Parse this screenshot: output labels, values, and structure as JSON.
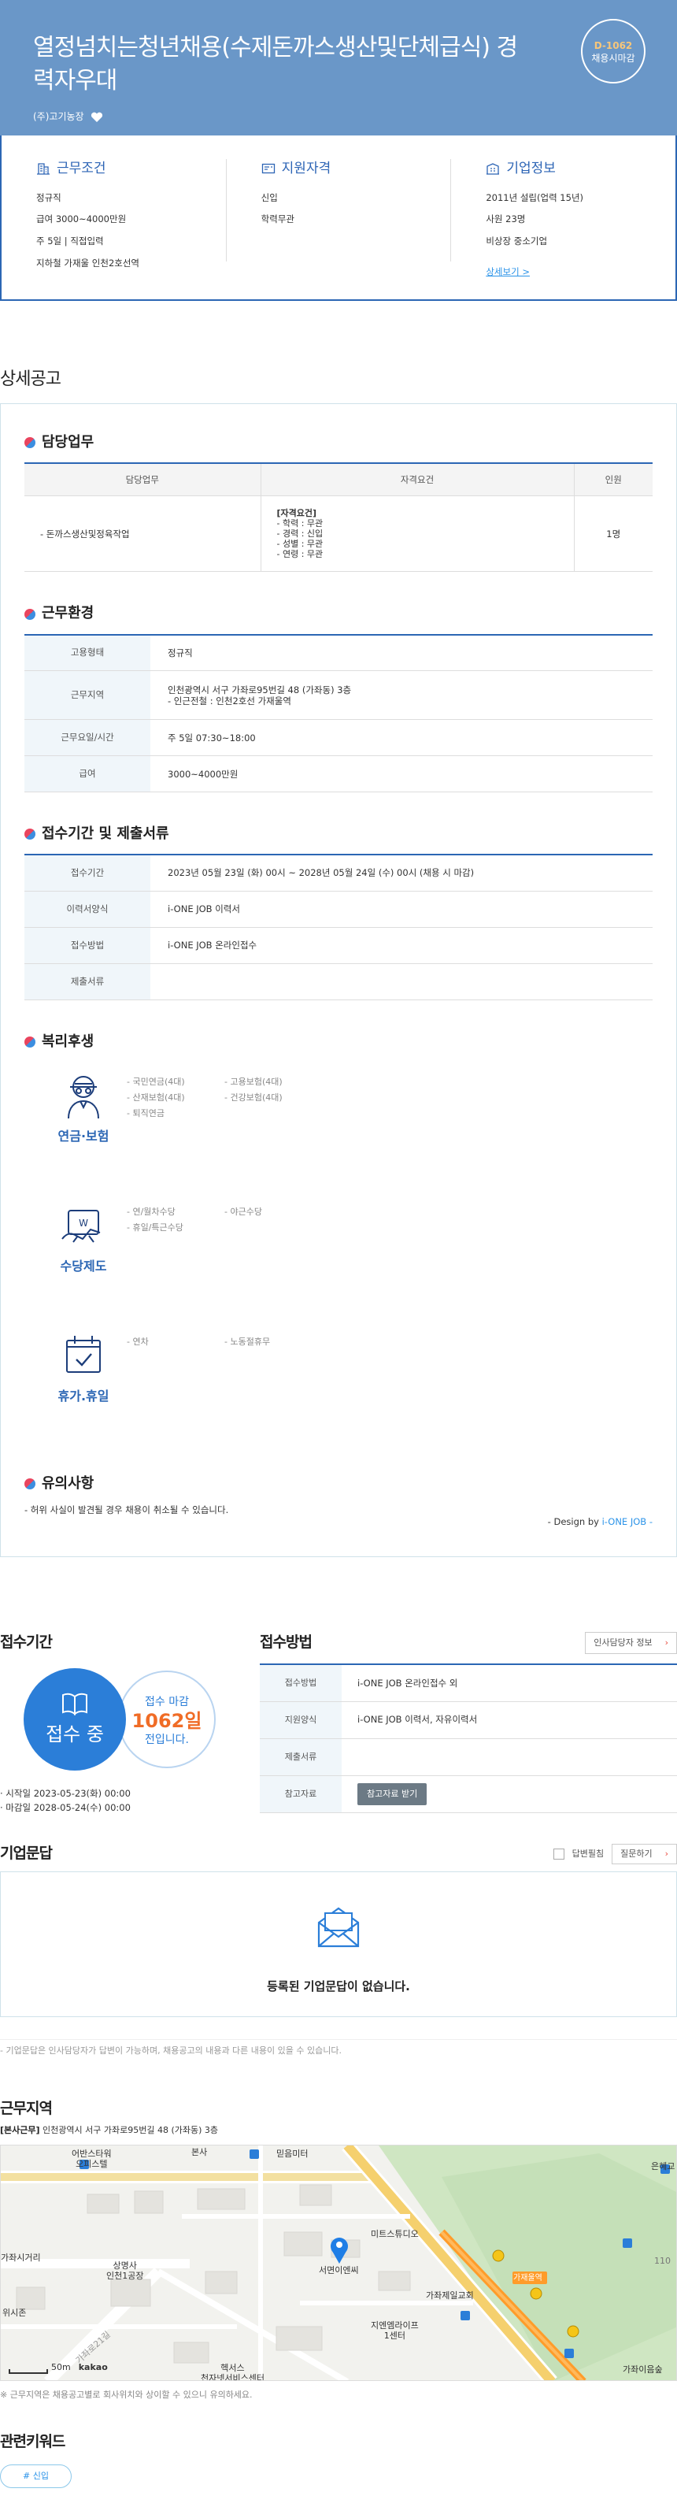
{
  "header": {
    "title": "열정넘치는청년채용(수제돈까스생산및단체급식) 경력자우대",
    "company": "(주)고기농장",
    "dday": "D-1062",
    "dday_sub": "채용시마감"
  },
  "summary": {
    "work": {
      "title": "근무조건",
      "items": [
        "정규직",
        "급여 3000~4000만원",
        "주 5일 | 직접입력",
        "지하철 가재울 인천2호선역"
      ]
    },
    "qual": {
      "title": "지원자격",
      "items": [
        "신입",
        "학력무관"
      ]
    },
    "corp": {
      "title": "기업정보",
      "items": [
        "2011년 설립(업력 15년)",
        "사원 23명",
        "비상장 중소기업"
      ],
      "more": "상세보기 >"
    }
  },
  "detail": {
    "heading": "상세공고",
    "duty": {
      "title": "담당업무",
      "headers": [
        "담당업무",
        "자격요건",
        "인원"
      ],
      "duty": "- 돈까스생산및정육작업",
      "req": [
        "[자격요건]",
        "- 학력 : 무관",
        "- 경력 : 신입",
        "- 성별 : 무관",
        "- 연령 : 무관"
      ],
      "count": "1명"
    },
    "env": {
      "title": "근무환경",
      "rows": [
        {
          "k": "고용형태",
          "v": "정규직",
          "v2": ""
        },
        {
          "k": "근무지역",
          "v": "인천광역시 서구 가좌로95번길 48 (가좌동) 3층",
          "v2": "- 인근전철 : 인천2호선 가재울역"
        },
        {
          "k": "근무요일/시간",
          "v": "주 5일 07:30~18:00",
          "v2": ""
        },
        {
          "k": "급여",
          "v": "3000~4000만원",
          "v2": ""
        }
      ]
    },
    "docs": {
      "title": "접수기간 및 제출서류",
      "rows": [
        {
          "k": "접수기간",
          "v": "2023년 05월 23일 (화) 00시 ~ 2028년 05월 24일 (수) 00시 (채용 시 마감)"
        },
        {
          "k": "이력서양식",
          "v": "i-ONE JOB 이력서"
        },
        {
          "k": "접수방법",
          "v": "i-ONE JOB 온라인접수"
        },
        {
          "k": "제출서류",
          "v": ""
        }
      ]
    },
    "welfare": {
      "title": "복리후생",
      "groups": [
        {
          "label": "연금·보험",
          "icon": "pension-icon",
          "items": [
            "- 국민연금(4대)",
            "- 고용보험(4대)",
            "- 산재보험(4대)",
            "- 건강보험(4대)",
            "- 퇴직연금",
            ""
          ]
        },
        {
          "label": "수당제도",
          "icon": "allowance-icon",
          "items": [
            "- 연/월차수당",
            "- 야근수당",
            "- 휴일/특근수당",
            ""
          ]
        },
        {
          "label": "휴가.휴일",
          "icon": "calendar-check-icon",
          "items": [
            "- 연차",
            "- 노동절휴무"
          ]
        }
      ]
    },
    "caution": {
      "title": "유의사항",
      "text": "- 허위 사실이 발견될 경우 채용이 취소될 수 있습니다."
    },
    "design_prefix": "- Design by ",
    "design_brand": "i-ONE JOB -"
  },
  "receipt": {
    "title": "접수기간",
    "status": "접수 중",
    "deadline_label": "접수 마감",
    "deadline_days": "1062일",
    "deadline_suffix": "전입니다.",
    "start": "· 시작일 2023-05-23(화) 00:00",
    "end": "· 마감일 2028-05-24(수) 00:00"
  },
  "method": {
    "title": "접수방법",
    "hr_button": "인사담당자 정보",
    "rows": [
      {
        "k": "접수방법",
        "v": "i-ONE JOB 온라인접수 외"
      },
      {
        "k": "지원양식",
        "v": "i-ONE JOB 이력서, 자유이력서"
      },
      {
        "k": "제출서류",
        "v": ""
      },
      {
        "k": "참고자료",
        "v": ""
      }
    ],
    "ref_button": "참고자료 받기"
  },
  "qna": {
    "title": "기업문답",
    "check_label": "답변필침",
    "ask_button": "질문하기",
    "empty": "등록된 기업문답이 없습니다.",
    "note": "- 기업문답은 인사담당자가 답변이 가능하며, 채용공고의 내용과 다른 내용이 있을 수 있습니다."
  },
  "location": {
    "title": "근무지역",
    "addr_tag": "[본사근무]",
    "addr": "인천광역시 서구 가좌로95번길 48 (가좌동) 3층",
    "labels": [
      "어반스타워\n오피스텔",
      "본사",
      "믿음미터",
      "은혜교",
      "미트스튜디오",
      "상명사\n인천1공장",
      "서면이엔씨",
      "가좌제일교회",
      "가재울역",
      "지엔엠라이프\n1센터",
      "헥서스\n천자넷서비스센터",
      "가좌시거리",
      "위시존",
      "가좌이음숲",
      "가좌로21길",
      "110"
    ],
    "scale": "50m",
    "brand": "kakao",
    "note": "※ 근무지역은 채용공고별로 회사위치와 상이할 수 있으니 유의하세요."
  },
  "keyword": {
    "title": "관련키워드",
    "tag": "# 신입"
  }
}
